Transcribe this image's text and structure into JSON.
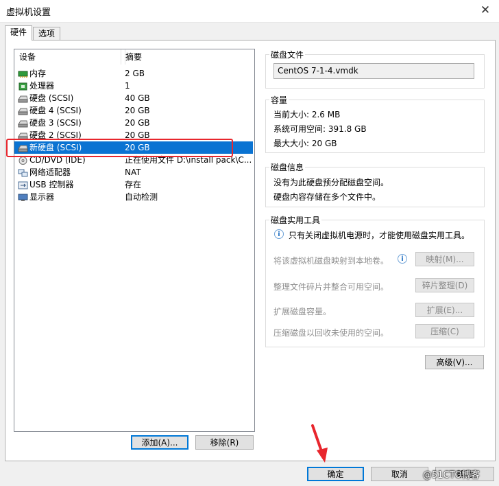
{
  "window": {
    "title": "虚拟机设置",
    "close_glyph": "✕"
  },
  "tabs": [
    {
      "label": "硬件"
    },
    {
      "label": "选项"
    }
  ],
  "device_list": {
    "headers": {
      "device": "设备",
      "summary": "摘要"
    },
    "rows": [
      {
        "device": "内存",
        "summary": "2 GB",
        "icon": "memory-icon"
      },
      {
        "device": "处理器",
        "summary": "1",
        "icon": "processor-icon"
      },
      {
        "device": "硬盘 (SCSI)",
        "summary": "40 GB",
        "icon": "hard-disk-icon"
      },
      {
        "device": "硬盘 4 (SCSI)",
        "summary": "20 GB",
        "icon": "hard-disk-icon"
      },
      {
        "device": "硬盘 3 (SCSI)",
        "summary": "20 GB",
        "icon": "hard-disk-icon"
      },
      {
        "device": "硬盘 2 (SCSI)",
        "summary": "20 GB",
        "icon": "hard-disk-icon"
      },
      {
        "device": "新硬盘 (SCSI)",
        "summary": "20 GB",
        "icon": "hard-disk-icon",
        "selected": true
      },
      {
        "device": "CD/DVD (IDE)",
        "summary": "正在使用文件 D:\\install pack\\C...",
        "icon": "cd-dvd-icon"
      },
      {
        "device": "网络适配器",
        "summary": "NAT",
        "icon": "network-adapter-icon"
      },
      {
        "device": "USB 控制器",
        "summary": "存在",
        "icon": "usb-icon"
      },
      {
        "device": "显示器",
        "summary": "自动检测",
        "icon": "display-icon"
      }
    ],
    "add_button": "添加(A)...",
    "remove_button": "移除(R)"
  },
  "disk_file": {
    "label": "磁盘文件",
    "value": "CentOS 7-1-4.vmdk"
  },
  "capacity": {
    "label": "容量",
    "current_size": "当前大小: 2.6 MB",
    "system_free": "系统可用空间: 391.8 GB",
    "max_size": "最大大小: 20 GB"
  },
  "disk_info": {
    "label": "磁盘信息",
    "line1": "没有为此硬盘预分配磁盘空间。",
    "line2": "硬盘内容存储在多个文件中。"
  },
  "disk_utilities": {
    "label": "磁盘实用工具",
    "notice": "只有关闭虚拟机电源时，才能使用磁盘实用工具。",
    "map_text": "将该虚拟机磁盘映射到本地卷。",
    "map_button": "映射(M)...",
    "defrag_text": "整理文件碎片并整合可用空间。",
    "defrag_button": "碎片整理(D)",
    "expand_text": "扩展磁盘容量。",
    "expand_button": "扩展(E)...",
    "compact_text": "压缩磁盘以回收未使用的空间。",
    "compact_button": "压缩(C)"
  },
  "advanced_button": "高级(V)...",
  "footer": {
    "ok": "确定",
    "cancel": "取消",
    "help": "帮助"
  },
  "watermark": "@51CTO博客",
  "colors": {
    "selection": "#0a73d2",
    "highlight_box": "#e8262d",
    "arrow": "#e8262d"
  }
}
